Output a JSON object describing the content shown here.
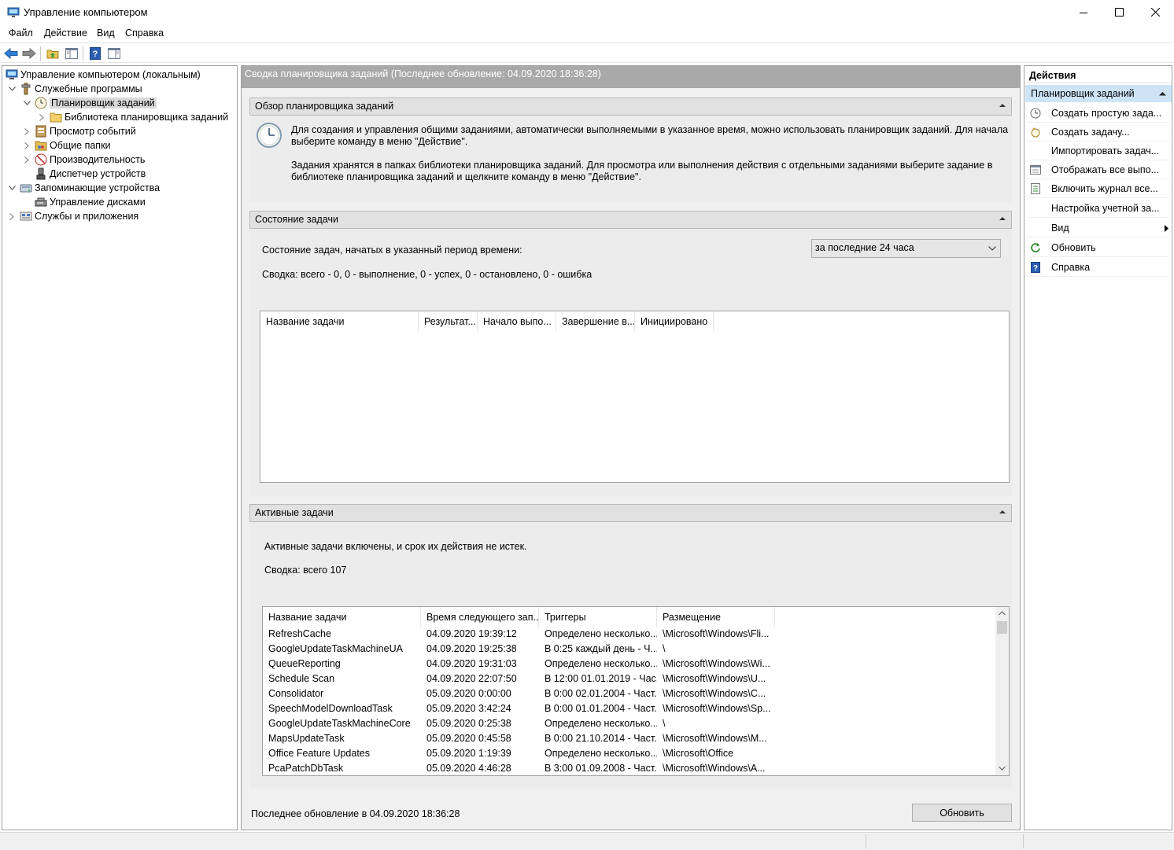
{
  "window": {
    "title": "Управление компьютером"
  },
  "menu": {
    "file": "Файл",
    "action": "Действие",
    "view": "Вид",
    "help": "Справка"
  },
  "tree": {
    "root": "Управление компьютером (локальным)",
    "items": [
      {
        "label": "Служебные программы"
      },
      {
        "label": "Планировщик заданий"
      },
      {
        "label": "Библиотека планировщика заданий"
      },
      {
        "label": "Просмотр событий"
      },
      {
        "label": "Общие папки"
      },
      {
        "label": "Производительность"
      },
      {
        "label": "Диспетчер устройств"
      },
      {
        "label": "Запоминающие устройства"
      },
      {
        "label": "Управление дисками"
      },
      {
        "label": "Службы и приложения"
      }
    ]
  },
  "center": {
    "header": "Сводка планировщика заданий (Последнее обновление: 04.09.2020 18:36:28)",
    "overview": {
      "title": "Обзор планировщика заданий",
      "p1_line1": "Для создания и управления общими заданиями, автоматически выполняемыми в указанное время, можно использовать планировщик заданий. Для начала",
      "p1_line2": "выберите команду в меню \"Действие\".",
      "p2_line1": "Задания хранятся в папках библиотеки планировщика заданий. Для просмотра или выполнения действия с отдельными заданиями выберите задание в",
      "p2_line2": "библиотеке планировщика заданий и щелкните команду в меню \"Действие\"."
    },
    "status": {
      "title": "Состояние задачи",
      "period_label": "Состояние задач, начатых в указанный период времени:",
      "period_value": "за последние 24 часа",
      "summary": "Сводка: всего - 0, 0 - выполнение, 0 - успех, 0 - остановлено, 0 - ошибка",
      "columns": [
        "Название задачи",
        "Результат...",
        "Начало выпо...",
        "Завершение в...",
        "Инициировано"
      ]
    },
    "active": {
      "title": "Активные задачи",
      "description": "Активные задачи включены, и срок их действия не истек.",
      "summary": "Сводка: всего 107",
      "columns": [
        "Название задачи",
        "Время следующего зап...",
        "Триггеры",
        "Размещение"
      ],
      "rows": [
        [
          "RefreshCache",
          "04.09.2020 19:39:12",
          "Определено несколько...",
          "\\Microsoft\\Windows\\Fli..."
        ],
        [
          "GoogleUpdateTaskMachineUA",
          "04.09.2020 19:25:38",
          "В 0:25 каждый день - Ч...",
          "\\"
        ],
        [
          "QueueReporting",
          "04.09.2020 19:31:03",
          "Определено несколько...",
          "\\Microsoft\\Windows\\Wi..."
        ],
        [
          "Schedule Scan",
          "04.09.2020 22:07:50",
          "В 12:00 01.01.2019 - Час...",
          "\\Microsoft\\Windows\\U..."
        ],
        [
          "Consolidator",
          "05.09.2020 0:00:00",
          "В 0:00 02.01.2004 - Част...",
          "\\Microsoft\\Windows\\C..."
        ],
        [
          "SpeechModelDownloadTask",
          "05.09.2020 3:42:24",
          "В 0:00 01.01.2004 - Част...",
          "\\Microsoft\\Windows\\Sp..."
        ],
        [
          "GoogleUpdateTaskMachineCore",
          "05.09.2020 0:25:38",
          "Определено несколько...",
          "\\"
        ],
        [
          "MapsUpdateTask",
          "05.09.2020 0:45:58",
          "В 0:00 21.10.2014 - Част...",
          "\\Microsoft\\Windows\\M..."
        ],
        [
          "Office Feature Updates",
          "05.09.2020 1:19:39",
          "Определено несколько...",
          "\\Microsoft\\Office"
        ],
        [
          "PcaPatchDbTask",
          "05.09.2020 4:46:28",
          "В 3:00 01.09.2008 - Част...",
          "\\Microsoft\\Windows\\A..."
        ]
      ]
    },
    "footer": {
      "last_update": "Последнее обновление в 04.09.2020 18:36:28",
      "refresh_button": "Обновить"
    }
  },
  "actions": {
    "title": "Действия",
    "group": "Планировщик заданий",
    "items": [
      {
        "label": "Создать простую зада...",
        "icon": "create-basic-task-icon"
      },
      {
        "label": "Создать задачу...",
        "icon": "create-task-icon"
      },
      {
        "label": "Импортировать задач...",
        "icon": ""
      },
      {
        "label": "Отображать все выпо...",
        "icon": "display-running-icon"
      },
      {
        "label": "Включить журнал все...",
        "icon": "enable-history-icon"
      },
      {
        "label": "Настройка учетной за...",
        "icon": ""
      },
      {
        "label": "Вид",
        "icon": ""
      },
      {
        "label": "Обновить",
        "icon": "refresh-icon"
      },
      {
        "label": "Справка",
        "icon": "help-icon"
      }
    ]
  }
}
